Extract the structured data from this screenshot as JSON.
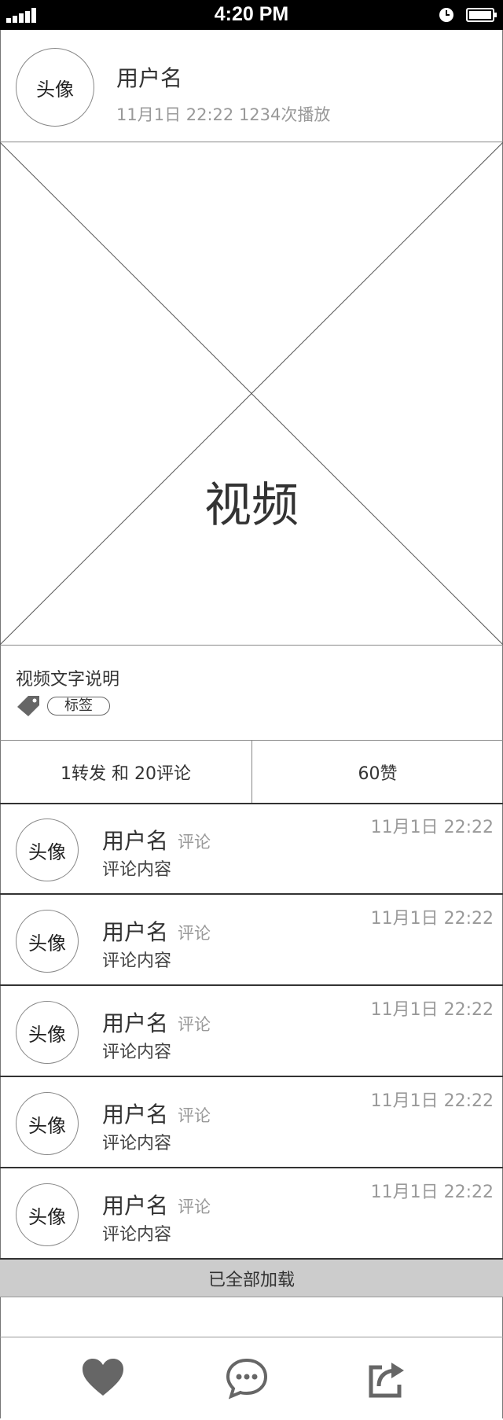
{
  "status_bar": {
    "time": "4:20 PM"
  },
  "author": {
    "avatar_label": "头像",
    "username": "用户名",
    "meta": "11月1日 22:22  1234次播放"
  },
  "video": {
    "label": "视频"
  },
  "description": "视频文字说明",
  "tag": {
    "icon": "tag-icon",
    "label": "标签"
  },
  "stats": {
    "reposts_comments": "1转发 和 20评论",
    "likes": "60赞"
  },
  "comments": [
    {
      "avatar_label": "头像",
      "username": "用户名",
      "tag": "评论",
      "content": "评论内容",
      "time": "11月1日 22:22"
    },
    {
      "avatar_label": "头像",
      "username": "用户名",
      "tag": "评论",
      "content": "评论内容",
      "time": "11月1日 22:22"
    },
    {
      "avatar_label": "头像",
      "username": "用户名",
      "tag": "评论",
      "content": "评论内容",
      "time": "11月1日 22:22"
    },
    {
      "avatar_label": "头像",
      "username": "用户名",
      "tag": "评论",
      "content": "评论内容",
      "time": "11月1日 22:22"
    },
    {
      "avatar_label": "头像",
      "username": "用户名",
      "tag": "评论",
      "content": "评论内容",
      "time": "11月1日 22:22"
    }
  ],
  "loaded_text": "已全部加载",
  "toolbar": {
    "icons": [
      "heart-icon",
      "comment-bubble-icon",
      "share-icon"
    ]
  },
  "colors": {
    "icon_gray": "#666666",
    "loaded_bg": "#cccccc"
  }
}
